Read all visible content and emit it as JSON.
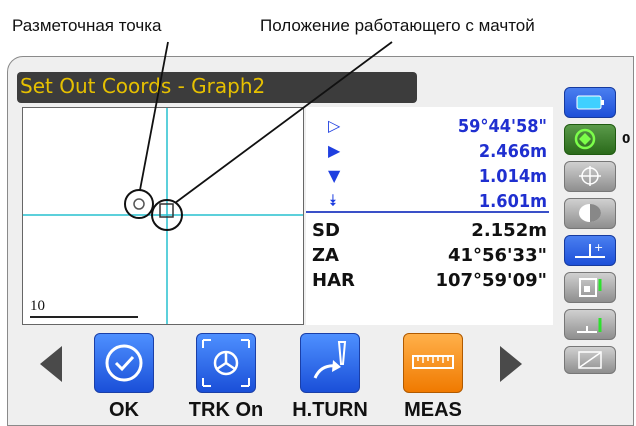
{
  "annotations": {
    "set_out_point": "Разметочная точка",
    "pole_position": "Положение работающего с мачтой"
  },
  "screen_title": "Set Out Coords - Graph2",
  "graph": {
    "scale_label": "10"
  },
  "readings": {
    "angle_diff": "59°44'58\"",
    "forward_back": "2.466m",
    "left_right": "1.014m",
    "cut_fill": "1.601m",
    "measured": [
      {
        "label": "SD",
        "value": "2.152m"
      },
      {
        "label": "ZA",
        "value": "41°56'33\""
      },
      {
        "label": "HAR",
        "value": "107°59'09\""
      }
    ]
  },
  "sidebar": {
    "target_count": "0"
  },
  "softkeys": [
    {
      "label": "OK",
      "icon": "check-circle-icon"
    },
    {
      "label": "TRK On",
      "icon": "tracking-icon"
    },
    {
      "label": "H.TURN",
      "icon": "horizontal-turn-icon"
    },
    {
      "label": "MEAS",
      "icon": "measure-ruler-icon"
    }
  ],
  "colors": {
    "title_text": "#e6c000",
    "value_blue": "#1f2fd0",
    "graph_axis": "#27c0cf",
    "softkey_blue": "#2a5ee8",
    "softkey_orange": "#f49a1f"
  }
}
